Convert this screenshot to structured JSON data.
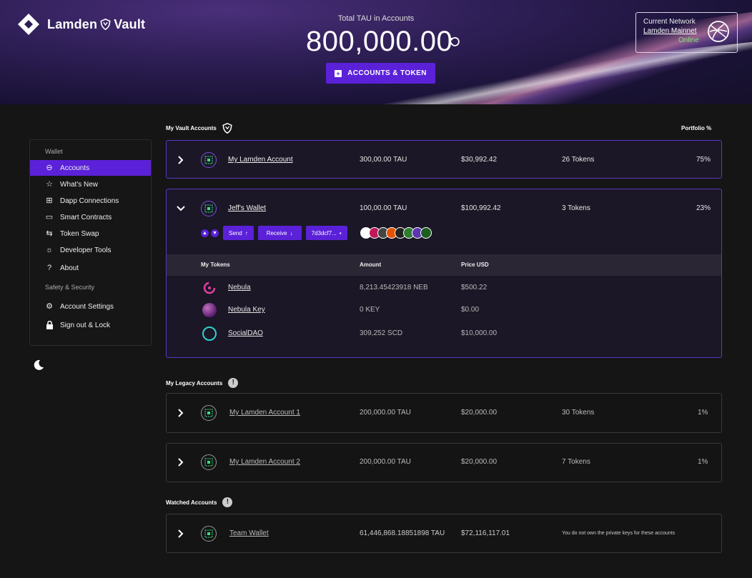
{
  "header": {
    "app_name": "Lamden",
    "app_suffix": "Vault",
    "total_label": "Total TAU in Accounts",
    "total_amount": "800,000.00",
    "accounts_token_button": "ACCOUNTS & TOKEN",
    "network": {
      "label": "Current Network",
      "name": "Lamden Mainnet",
      "status": "Online"
    }
  },
  "sidebar": {
    "wallet_section": "Wallet",
    "items": [
      {
        "label": "Accounts",
        "icon": "wallet-icon"
      },
      {
        "label": "What's New",
        "icon": "star-icon"
      },
      {
        "label": "Dapp Connections",
        "icon": "grid-icon"
      },
      {
        "label": "Smart Contracts",
        "icon": "contract-icon"
      },
      {
        "label": "Token Swap",
        "icon": "swap-icon"
      },
      {
        "label": "Developer Tools",
        "icon": "lightbulb-icon"
      },
      {
        "label": "About",
        "icon": "help-icon"
      }
    ],
    "safety_section": "Safety & Security",
    "safety_items": [
      {
        "label": "Account Settings",
        "icon": "gear-icon"
      },
      {
        "label": "Sign out & Lock",
        "icon": "lock-icon"
      }
    ]
  },
  "vault": {
    "title": "My Vault Accounts",
    "portfolio_label": "Portfolio %",
    "accounts": [
      {
        "name": "My Lamden Account",
        "amount": "300,00.00 TAU",
        "usd": "$30,992.42",
        "tokens": "26 Tokens",
        "portfolio": "75%"
      },
      {
        "name": "Jeff's Wallet",
        "amount": "100,00.00 TAU",
        "usd": "$100,992.42",
        "tokens": "3 Tokens",
        "portfolio": "23%"
      }
    ],
    "actions": {
      "send": "Send",
      "receive": "Receive",
      "address": "7d3dcf7..."
    },
    "token_table": {
      "headers": {
        "token": "My Tokens",
        "amount": "Amount",
        "price": "Price USD"
      },
      "rows": [
        {
          "name": "Nebula",
          "amount": "8,213.45423918 NEB",
          "price": "$500.22"
        },
        {
          "name": "Nebula Key",
          "amount": "0 KEY",
          "price": "$0.00"
        },
        {
          "name": "SocialDAO",
          "amount": "309,252 SCD",
          "price": "$10,000.00"
        }
      ]
    }
  },
  "legacy": {
    "title": "My Legacy Accounts",
    "accounts": [
      {
        "name": "My Lamden Account 1",
        "amount": "200,000.00 TAU",
        "usd": "$20,000.00",
        "tokens": "30 Tokens",
        "portfolio": "1%"
      },
      {
        "name": "My Lamden Account 2",
        "amount": "200,000.00 TAU",
        "usd": "$20,000.00",
        "tokens": "7 Tokens",
        "portfolio": "1%"
      }
    ]
  },
  "watched": {
    "title": "Watched Accounts",
    "accounts": [
      {
        "name": "Team Wallet",
        "amount": "61,446,868.18851898 TAU",
        "usd": "$72,116,117.01",
        "note": "You do not own the private keys for these accounts"
      }
    ]
  },
  "colors": {
    "accent": "#5b21d9",
    "online": "#7ee07e"
  }
}
